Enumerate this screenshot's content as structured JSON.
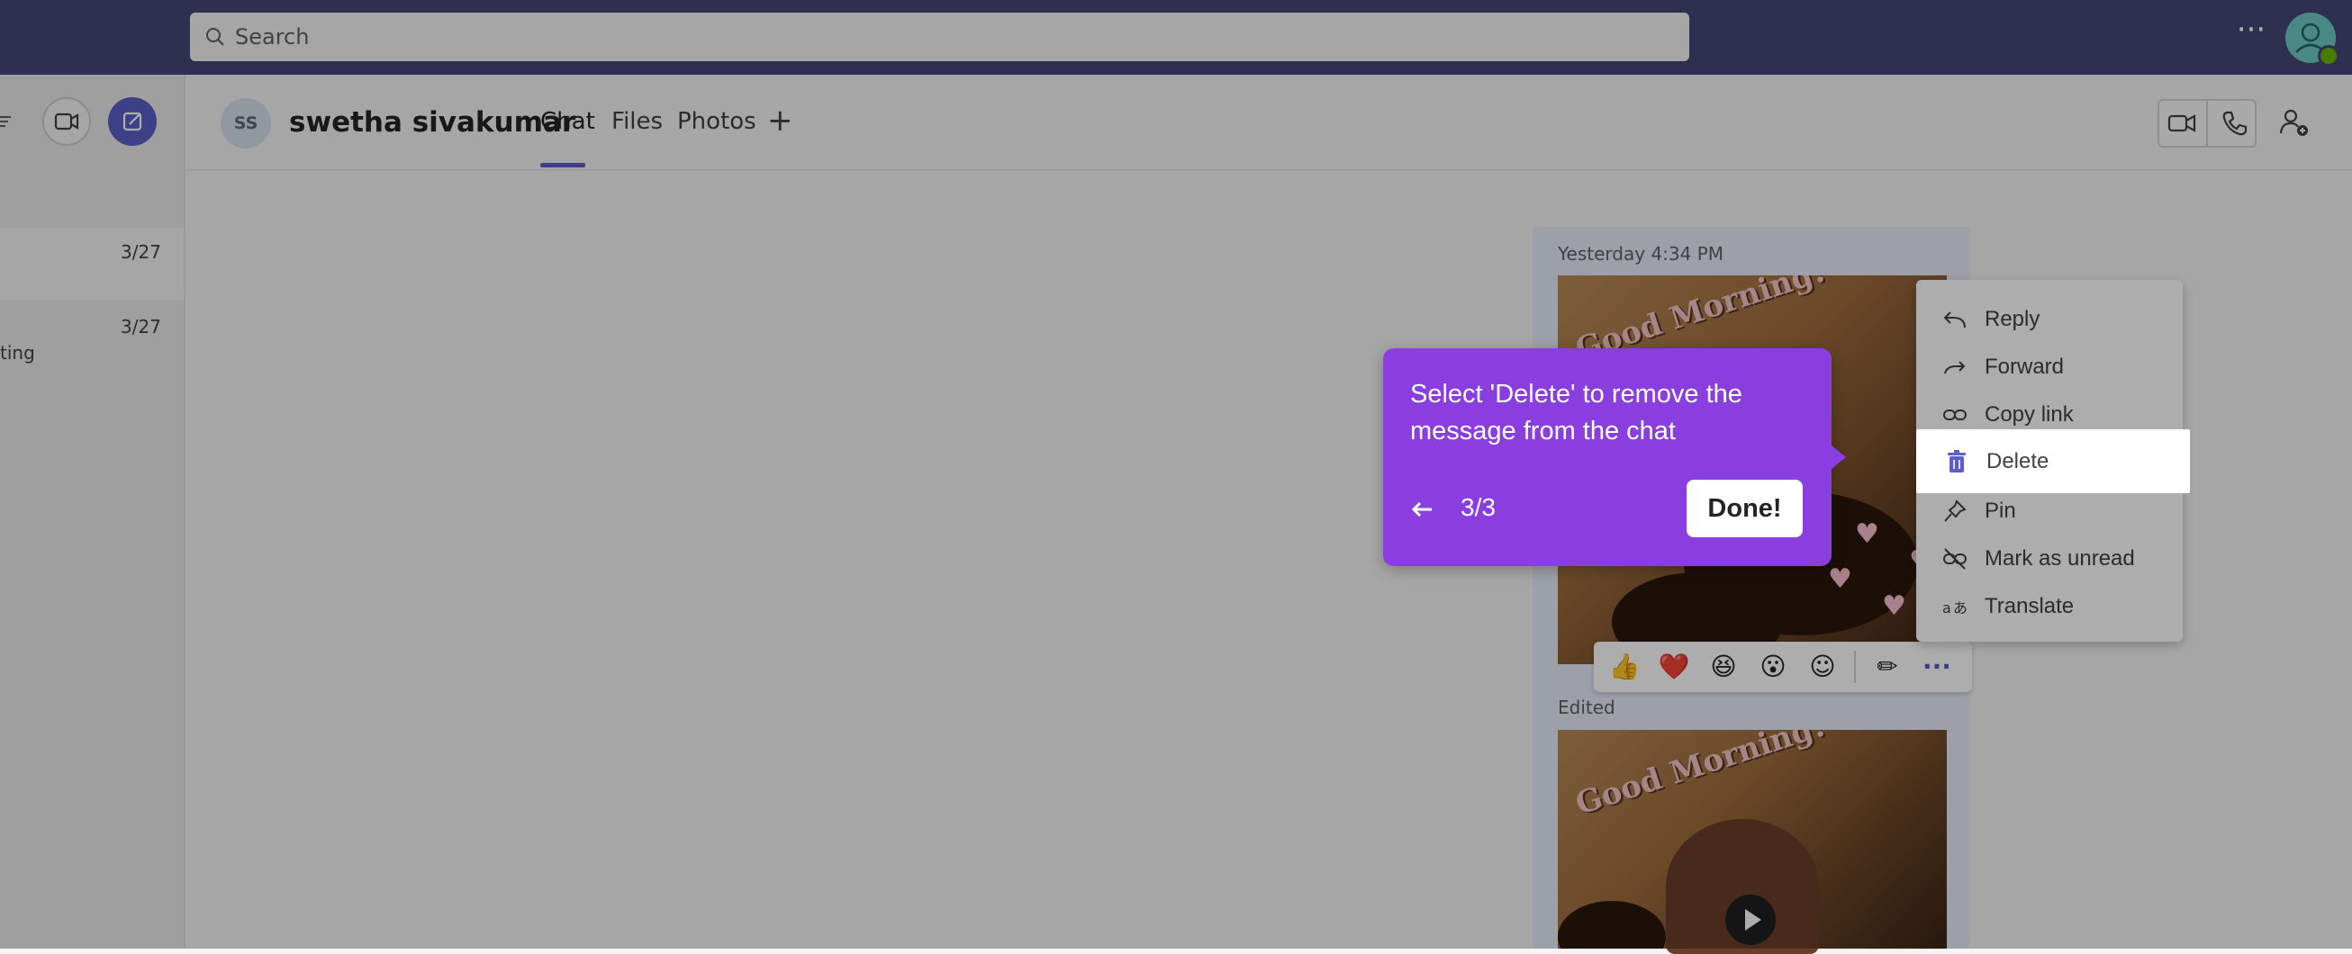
{
  "search": {
    "placeholder": "Search"
  },
  "chat_list": [
    {
      "date": "3/27",
      "snippet": ""
    },
    {
      "date": "3/27",
      "snippet": "ting"
    }
  ],
  "header": {
    "avatar_initials": "SS",
    "contact_name": "swetha sivakumar",
    "tabs": [
      {
        "label": "Chat",
        "active": true
      },
      {
        "label": "Files"
      },
      {
        "label": "Photos"
      }
    ],
    "add_tab": "+"
  },
  "messages": {
    "time": "Yesterday 4:34 PM",
    "edited_label": "Edited",
    "image_caption": "Good Morning!"
  },
  "reactions": [
    "👍",
    "❤️",
    "😆",
    "😮",
    "☺",
    "✏",
    "···"
  ],
  "context_menu": {
    "items": [
      {
        "label": "Reply",
        "icon": "reply-icon"
      },
      {
        "label": "Forward",
        "icon": "forward-icon"
      },
      {
        "label": "Copy link",
        "icon": "link-icon"
      },
      {
        "label": "Delete",
        "icon": "trash-icon"
      },
      {
        "label": "Pin",
        "icon": "pin-icon"
      },
      {
        "label": "Mark as unread",
        "icon": "unread-icon"
      },
      {
        "label": "Translate",
        "icon": "translate-icon"
      }
    ]
  },
  "coach": {
    "text": "Select 'Delete' to remove the message from the chat",
    "step": "3/3",
    "done_label": "Done!"
  },
  "colors": {
    "topbar": "#464775",
    "accent": "#5b5fc7",
    "coach": "#8a3ee0",
    "message_bg": "#e8ebfa"
  }
}
